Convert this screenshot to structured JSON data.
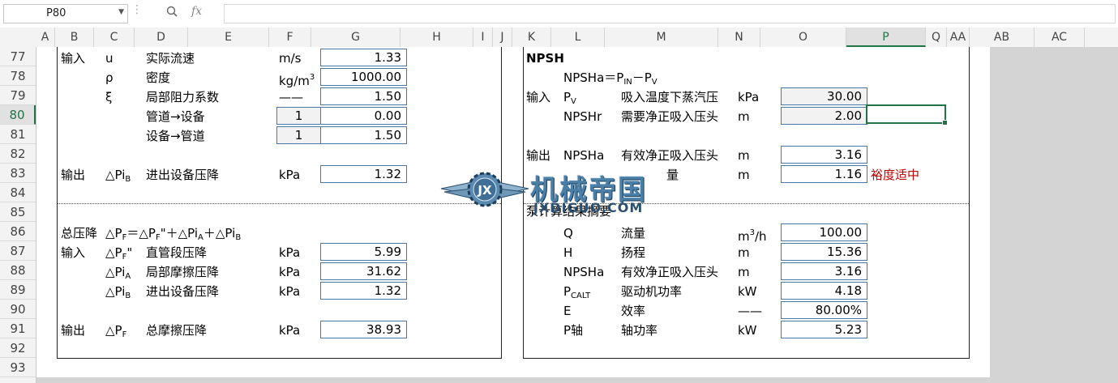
{
  "formula_bar": {
    "name_box": "P80",
    "fx": "fx",
    "formula": ""
  },
  "columns": [
    "A",
    "B",
    "C",
    "D",
    "E",
    "F",
    "G",
    "H",
    "I",
    "J",
    "K",
    "L",
    "M",
    "N",
    "O",
    "P",
    "Q",
    "AA",
    "AB",
    "AC"
  ],
  "selected_column": "P",
  "rows": [
    "77",
    "78",
    "79",
    "80",
    "81",
    "82",
    "83",
    "84",
    "85",
    "86",
    "87",
    "88",
    "89",
    "90",
    "91",
    "92",
    "93"
  ],
  "selected_row": "80",
  "left": {
    "r77": {
      "label": "输入",
      "sym": "u",
      "name": "实际流速",
      "unit": "m/s",
      "value": "1.33"
    },
    "r78": {
      "sym": "ρ",
      "name": "密度",
      "unit": "kg/m",
      "unit_sup": "3",
      "value": "1000.00"
    },
    "r79": {
      "sym": "ξ",
      "name": "局部阻力系数",
      "unit": "——",
      "value": "1.50"
    },
    "r80": {
      "name": "管道→设备",
      "count": "1",
      "value": "0.00"
    },
    "r81": {
      "name": "设备→管道",
      "count": "1",
      "value": "1.50"
    },
    "r83": {
      "label": "输出",
      "sym": "△Pi",
      "sym_sub": "B",
      "name": "进出设备压降",
      "unit": "kPa",
      "value": "1.32"
    },
    "r86": {
      "label": "总压降",
      "f1": "△P",
      "f1s": "F",
      "f2": "＝△P",
      "f2s": "F",
      "f3": "\"＋△Pi",
      "f3s": "A",
      "f4": "＋△Pi",
      "f4s": "B"
    },
    "r87": {
      "label": "输入",
      "sym": "△P",
      "sym_sub": "F",
      "sym_suffix": "\"",
      "name": "直管段压降",
      "unit": "kPa",
      "value": "5.99"
    },
    "r88": {
      "sym": "△Pi",
      "sym_sub": "A",
      "name": "局部摩擦压降",
      "unit": "kPa",
      "value": "31.62"
    },
    "r89": {
      "sym": "△Pi",
      "sym_sub": "B",
      "name": "进出设备压降",
      "unit": "kPa",
      "value": "1.32"
    },
    "r91": {
      "label": "输出",
      "sym": "△P",
      "sym_sub": "F",
      "name": "总摩擦压降",
      "unit": "kPa",
      "value": "38.93"
    }
  },
  "right": {
    "r77": {
      "title": "NPSH"
    },
    "r78": {
      "f1": "NPSHa＝P",
      "f1s": "IN",
      "f2": "－P",
      "f2s": "V"
    },
    "r79": {
      "label": "输入",
      "sym": "P",
      "sym_sub": "V",
      "name": "吸入温度下蒸汽压",
      "unit": "kPa",
      "value": "30.00"
    },
    "r80": {
      "sym": "NPSHr",
      "name": "需要净正吸入压头",
      "unit": "m",
      "value": "2.00"
    },
    "r82": {
      "label": "输出",
      "sym": "NPSHa",
      "name": "有效净正吸入压头",
      "unit": "m",
      "value": "3.16"
    },
    "r83": {
      "name_partial": "量",
      "unit": "m",
      "value": "1.16",
      "note": "裕度适中"
    },
    "r85": {
      "title_partial": "泵计算结果摘要"
    },
    "r86": {
      "sym": "Q",
      "name": "流量",
      "unit": "m",
      "unit_sup": "3",
      "unit_suffix": "/h",
      "value": "100.00"
    },
    "r87": {
      "sym": "H",
      "name": "扬程",
      "unit": "m",
      "value": "15.36"
    },
    "r88": {
      "sym": "NPSHa",
      "name": "有效净正吸入压头",
      "unit": "m",
      "value": "3.16"
    },
    "r89": {
      "sym": "P",
      "sym_sub": "CALT",
      "name": "驱动机功率",
      "unit": "kW",
      "value": "4.18"
    },
    "r90": {
      "sym": "E",
      "name": "效率",
      "unit": "——",
      "value": "80.00%"
    },
    "r91": {
      "sym": "P轴",
      "name": "轴功率",
      "unit": "kW",
      "value": "5.23"
    }
  },
  "watermark": {
    "cn": "机械帝国",
    "en": "JXDIGUO.COM",
    "logo": "JX"
  }
}
